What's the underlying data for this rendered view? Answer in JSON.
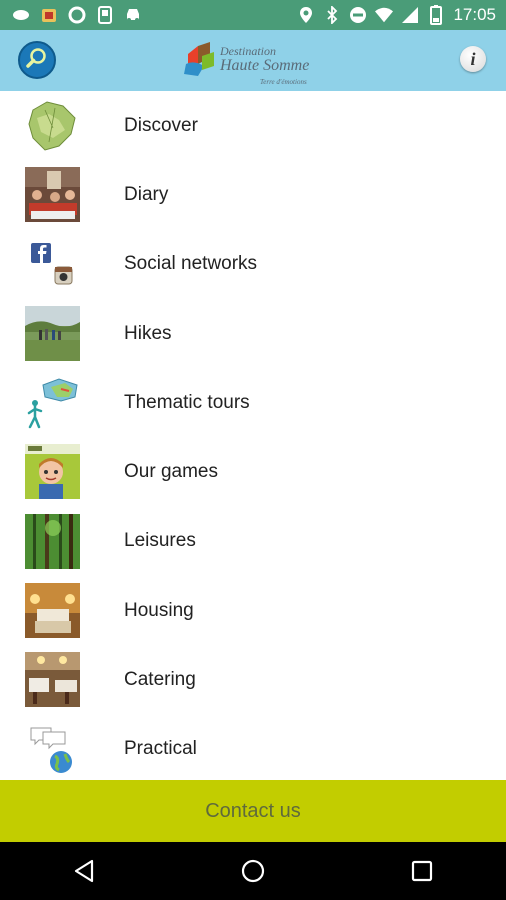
{
  "status_bar": {
    "time": "17:05",
    "left_icons": [
      "chat-bubble-icon",
      "app-notification-icon",
      "circle-icon",
      "phone-icon",
      "car-icon"
    ],
    "right_icons": [
      "location-icon",
      "bluetooth-icon",
      "do-not-disturb-icon",
      "wifi-icon",
      "signal-icon",
      "battery-icon"
    ]
  },
  "app_bar": {
    "logo_line1": "Destination",
    "logo_line2": "Haute Somme",
    "logo_tagline": "Terre d'émotions"
  },
  "menu": {
    "items": [
      {
        "label": "Discover",
        "icon": "map-icon"
      },
      {
        "label": "Diary",
        "icon": "event-photo-icon"
      },
      {
        "label": "Social networks",
        "icon": "facebook-instagram-icon"
      },
      {
        "label": "Hikes",
        "icon": "hikers-photo-icon"
      },
      {
        "label": "Thematic tours",
        "icon": "walker-map-icon"
      },
      {
        "label": "Our games",
        "icon": "game-character-icon"
      },
      {
        "label": "Leisures",
        "icon": "forest-photo-icon"
      },
      {
        "label": "Housing",
        "icon": "bedroom-photo-icon"
      },
      {
        "label": "Catering",
        "icon": "restaurant-photo-icon"
      },
      {
        "label": "Practical",
        "icon": "globe-chat-icon"
      }
    ]
  },
  "contact": {
    "label": "Contact us"
  },
  "colors": {
    "status_bar": "#4a9c78",
    "app_bar": "#8fd1e8",
    "contact_bar": "#c2cd00",
    "nav_bar": "#000000"
  }
}
